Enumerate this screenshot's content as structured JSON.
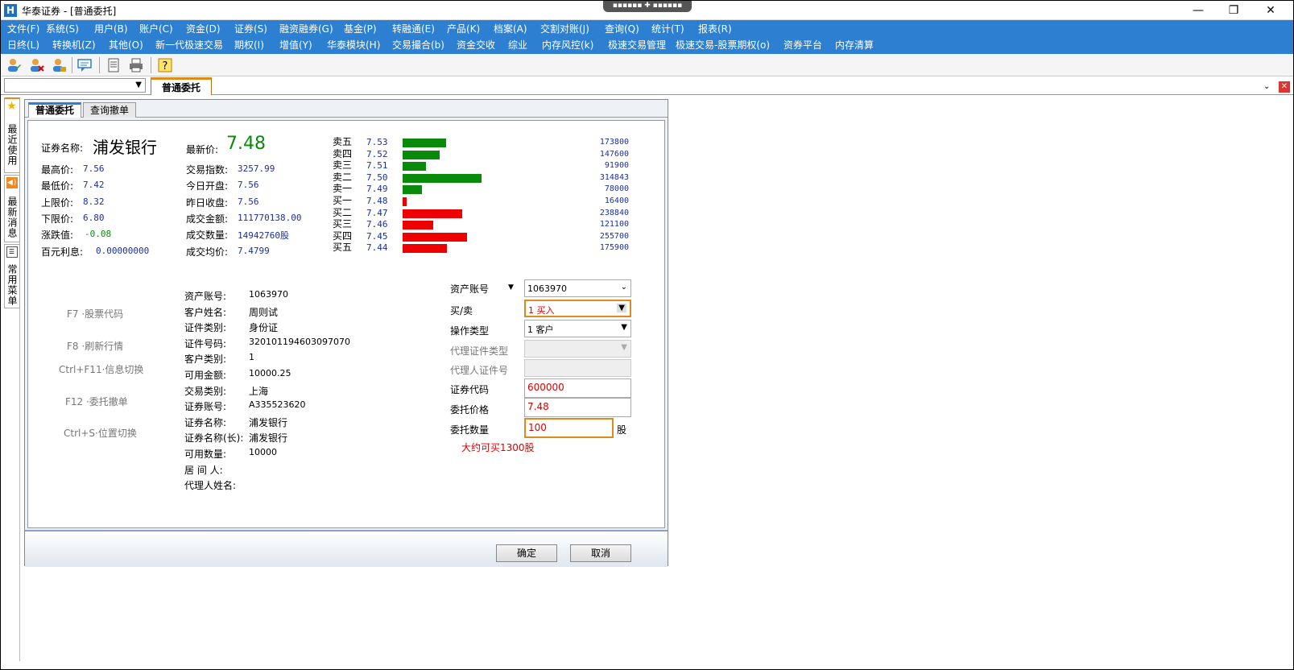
{
  "app": {
    "title": "华泰证券 - [普通委托]",
    "logo": "H",
    "drag_handle": "▪▪▪▪▪▪ ✚ ▪▪▪▪▪▪"
  },
  "menubar": {
    "row1": [
      "文件(F)",
      "系统(S)",
      "用户(B)",
      "账户(C)",
      "资金(D)",
      "证券(S)",
      "融资融券(G)",
      "基金(P)",
      "转融通(E)",
      "产品(K)",
      "档案(A)",
      "交割对账(J)",
      "查询(Q)",
      "统计(T)",
      "报表(R)"
    ],
    "row2": [
      "日终(L)",
      "转换机(Z)",
      "其他(O)",
      "新一代极速交易",
      "期权(I)",
      "增值(Y)",
      "华泰模块(H)",
      "交易撮合(b)",
      "资金交收",
      "综业",
      "内存风控(k)",
      "极速交易管理",
      "极速交易-股票期权(o)",
      "资券平台",
      "内存清算"
    ]
  },
  "toolbar": {
    "icons": [
      "user-edit-icon",
      "user-delete-icon",
      "user-lock-icon",
      "message-icon",
      "document-icon",
      "printer-icon",
      "help-icon"
    ]
  },
  "tabstrip": {
    "combo_value": "",
    "active_tab": "普通委托"
  },
  "leftbar": {
    "tabs": [
      "最近使用",
      "最新消息",
      "常用菜单"
    ]
  },
  "dialog": {
    "subtabs": [
      "普通委托",
      "查询撤单"
    ],
    "quote": {
      "stock_name_label": "证券名称:",
      "stock_name": "浦发银行",
      "last_price_label": "最新价:",
      "last_price": "7.48",
      "left": [
        {
          "label": "最高价:",
          "value": "7.56"
        },
        {
          "label": "最低价:",
          "value": "7.42"
        },
        {
          "label": "上限价:",
          "value": "8.32"
        },
        {
          "label": "下限价:",
          "value": "6.80"
        },
        {
          "label": "涨跌值:",
          "value": "-0.08"
        },
        {
          "label": "百元利息:",
          "value": "0.00000000"
        }
      ],
      "mid": [
        {
          "label": "交易指数:",
          "value": "3257.99"
        },
        {
          "label": "今日开盘:",
          "value": "7.56"
        },
        {
          "label": "昨日收盘:",
          "value": "7.56"
        },
        {
          "label": "成交金额:",
          "value": "111770138.00"
        },
        {
          "label": "成交数量:",
          "value": "14942760股"
        },
        {
          "label": "成交均价:",
          "value": "7.4799"
        }
      ],
      "depth": [
        {
          "label": "卖五",
          "price": "7.53",
          "volume": "173800",
          "vol": 173800,
          "side": "sell"
        },
        {
          "label": "卖四",
          "price": "7.52",
          "volume": "147600",
          "vol": 147600,
          "side": "sell"
        },
        {
          "label": "卖三",
          "price": "7.51",
          "volume": "91900",
          "vol": 91900,
          "side": "sell"
        },
        {
          "label": "卖二",
          "price": "7.50",
          "volume": "314843",
          "vol": 314843,
          "side": "sell"
        },
        {
          "label": "卖一",
          "price": "7.49",
          "volume": "78000",
          "vol": 78000,
          "side": "sell"
        },
        {
          "label": "买一",
          "price": "7.48",
          "volume": "16400",
          "vol": 16400,
          "side": "buy"
        },
        {
          "label": "买二",
          "price": "7.47",
          "volume": "238840",
          "vol": 238840,
          "side": "buy"
        },
        {
          "label": "买三",
          "price": "7.46",
          "volume": "121100",
          "vol": 121100,
          "side": "buy"
        },
        {
          "label": "买四",
          "price": "7.45",
          "volume": "255700",
          "vol": 255700,
          "side": "buy"
        },
        {
          "label": "买五",
          "price": "7.44",
          "volume": "175900",
          "vol": 175900,
          "side": "buy"
        }
      ],
      "colors": {
        "sell": "#0a8a0a",
        "buy": "#ee0000"
      }
    },
    "hotkeys": [
      "F7 ·股票代码",
      "F8 ·刷新行情",
      "Ctrl+F11·信息切换",
      "F12 ·委托撤单",
      "Ctrl+S·位置切换"
    ],
    "info": [
      {
        "label": "资产账号:",
        "value": "1063970"
      },
      {
        "label": "客户姓名:",
        "value": "周则试"
      },
      {
        "label": "证件类别:",
        "value": "身份证"
      },
      {
        "label": "证件号码:",
        "value": "320101194603097070"
      },
      {
        "label": "客户类别:",
        "value": "1"
      },
      {
        "label": "可用金额:",
        "value": "10000.25"
      },
      {
        "label": "交易类别:",
        "value": "上海"
      },
      {
        "label": "证券账号:",
        "value": "A335523620"
      },
      {
        "label": "证券名称:",
        "value": "浦发银行"
      },
      {
        "label": "证券名称(长):",
        "value": "浦发银行"
      },
      {
        "label": "可用数量:",
        "value": "10000"
      },
      {
        "label": "居 间 人:",
        "value": ""
      },
      {
        "label": "代理人姓名:",
        "value": ""
      }
    ],
    "form": {
      "asset_account_label": "资产账号",
      "asset_account_value": "1063970",
      "buy_sell_label": "买/卖",
      "buy_sell_value": "1 买入",
      "op_type_label": "操作类型",
      "op_type_value": "1 客户",
      "agent_cert_type_label": "代理证件类型",
      "agent_cert_no_label": "代理人证件号",
      "stock_code_label": "证券代码",
      "stock_code_value": "600000",
      "price_label": "委托价格",
      "price_value": "7.48",
      "qty_label": "委托数量",
      "qty_value": "100",
      "qty_unit": "股",
      "hint": "大约可买1300股"
    },
    "buttons": {
      "ok": "确定",
      "cancel": "取消"
    }
  }
}
